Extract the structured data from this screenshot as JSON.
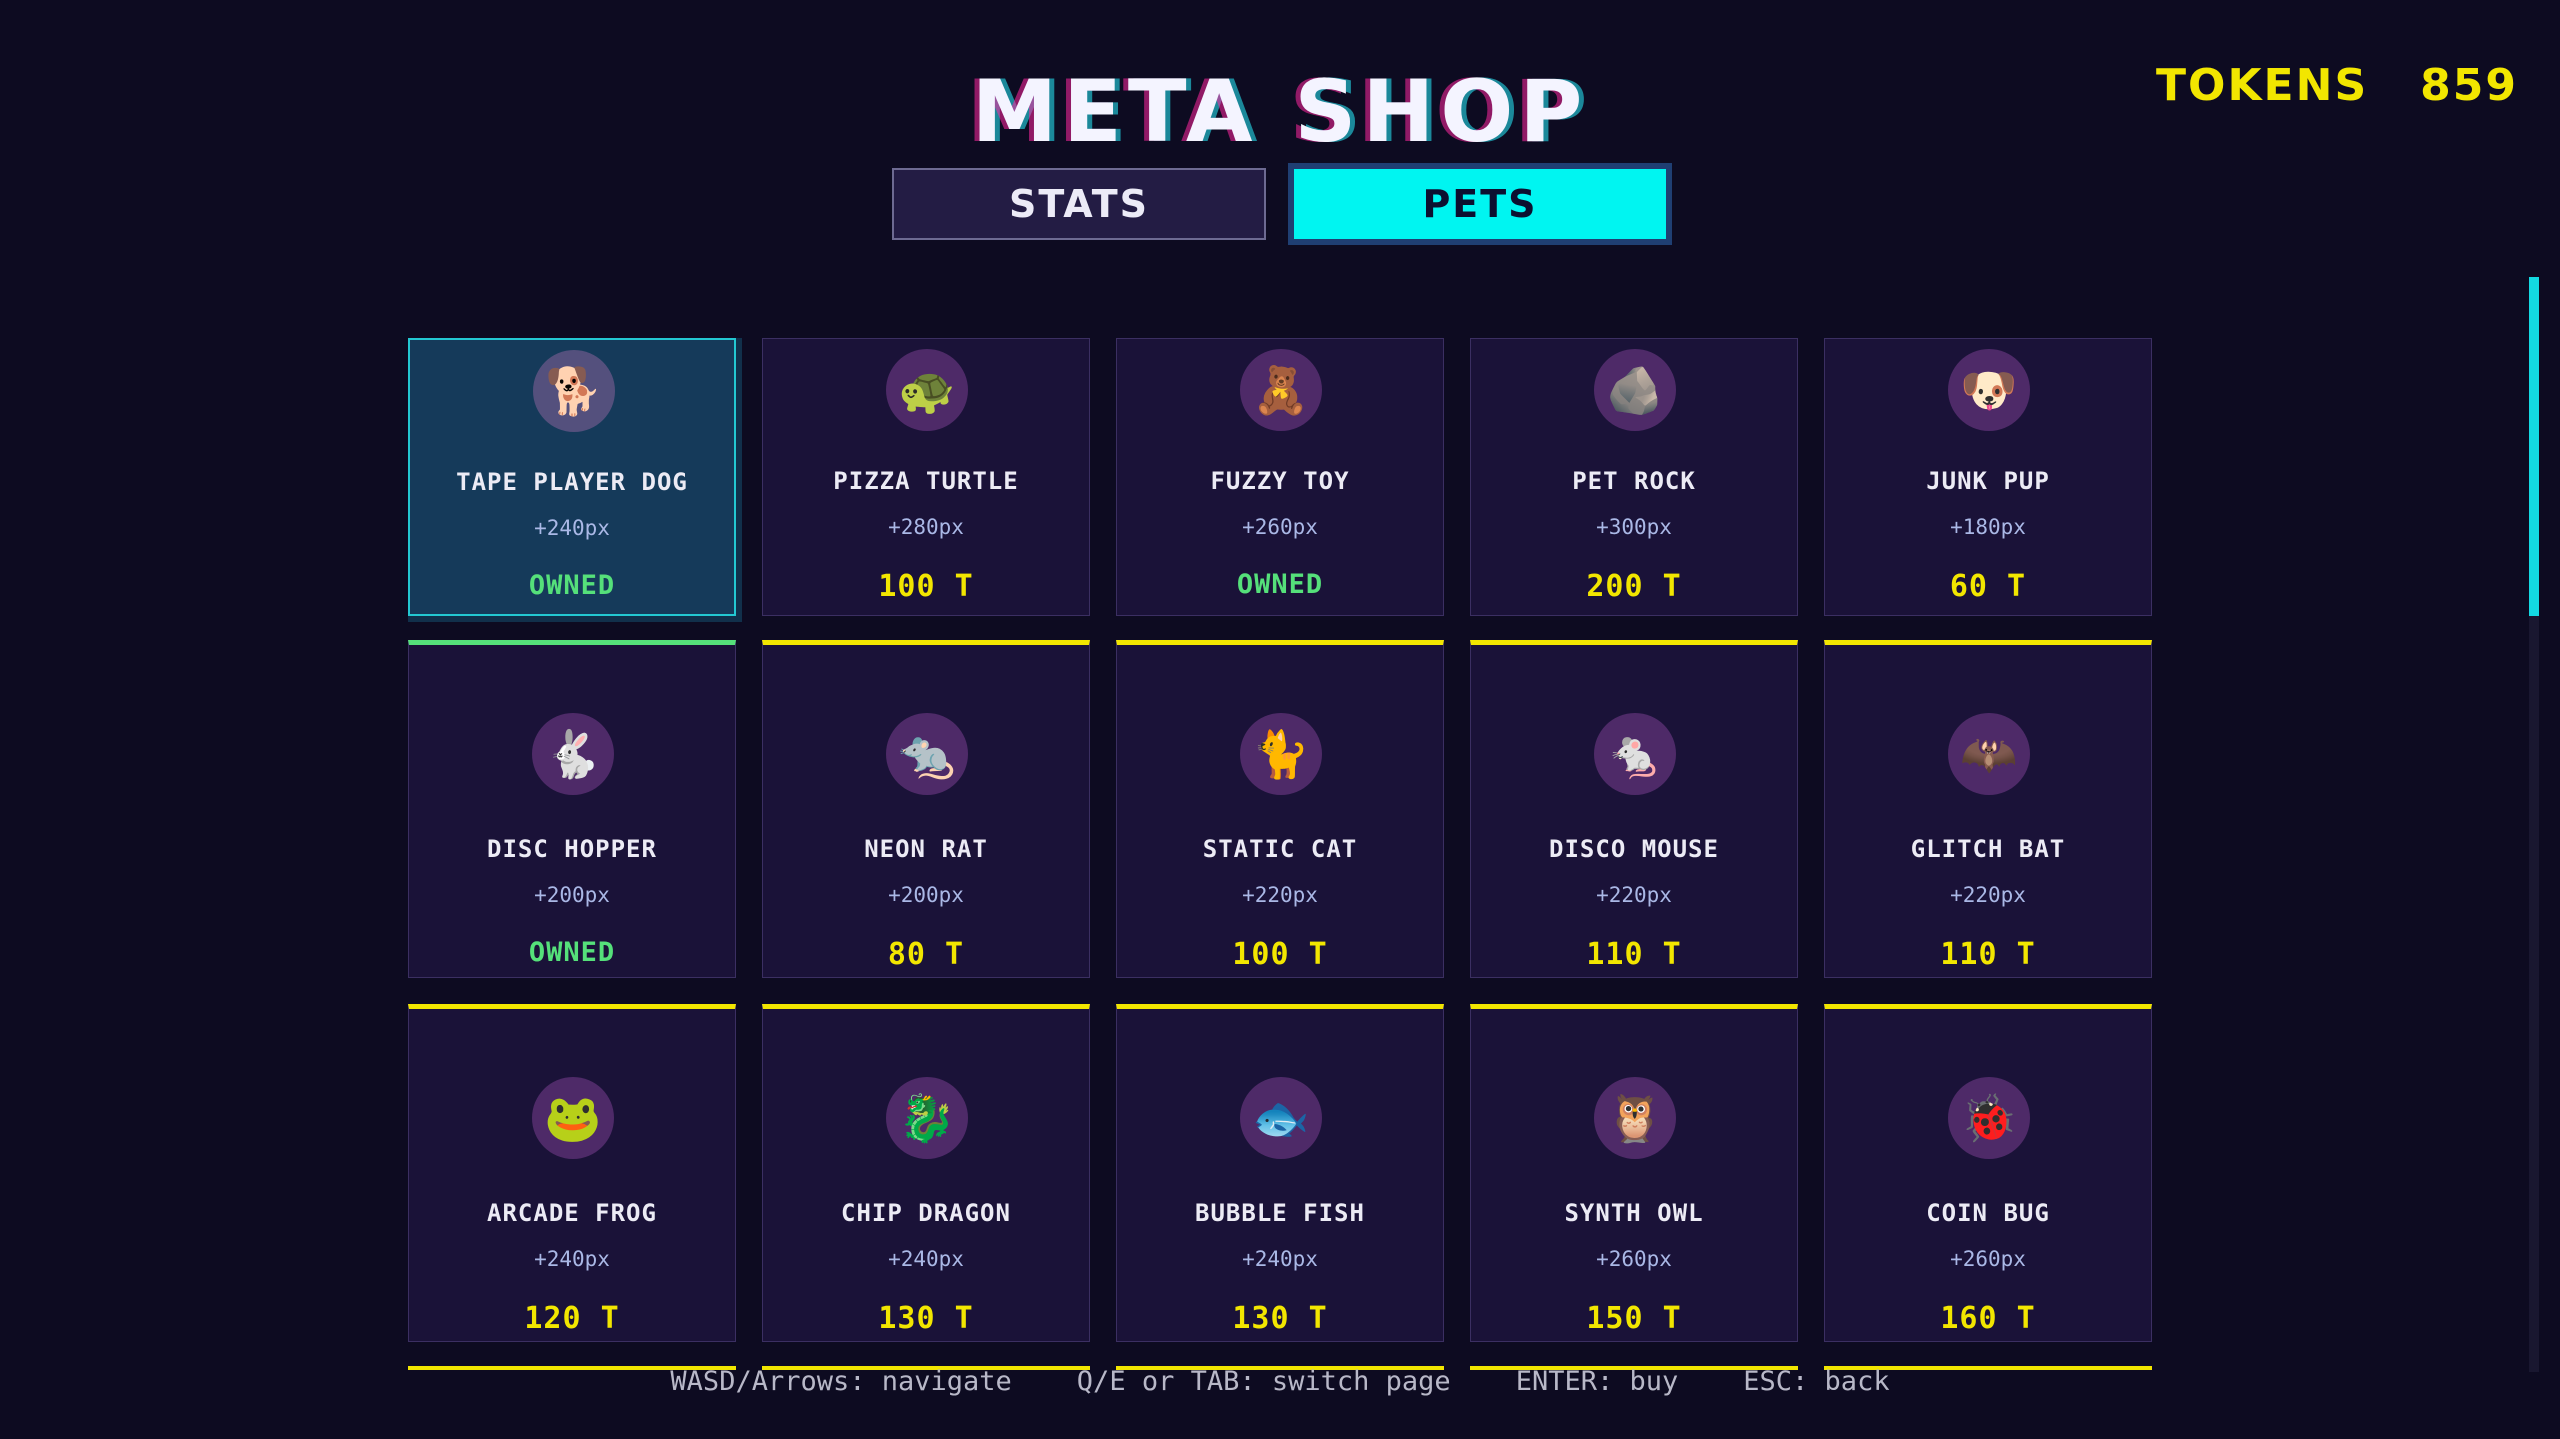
{
  "header": {
    "title": "META SHOP",
    "tokens_label": "TOKENS",
    "tokens_value": "859"
  },
  "tabs": [
    {
      "label": "STATS",
      "active": false
    },
    {
      "label": "PETS",
      "active": true
    }
  ],
  "pets": [
    {
      "name": "TAPE PLAYER DOG",
      "px": "+240px",
      "price": "OWNED",
      "owned": true,
      "selected": true,
      "icon": "dog-icon"
    },
    {
      "name": "PIZZA TURTLE",
      "px": "+280px",
      "price": "100 T",
      "owned": false,
      "icon": "turtle-icon"
    },
    {
      "name": "FUZZY TOY",
      "px": "+260px",
      "price": "OWNED",
      "owned": true,
      "icon": "fuzzy-toy-icon"
    },
    {
      "name": "PET ROCK",
      "px": "+300px",
      "price": "200 T",
      "owned": false,
      "icon": "rock-icon"
    },
    {
      "name": "JUNK PUP",
      "px": "+180px",
      "price": "60 T",
      "owned": false,
      "icon": "pup-icon"
    },
    {
      "name": "DISC HOPPER",
      "px": "+200px",
      "price": "OWNED",
      "owned": true,
      "icon": "rabbit-icon"
    },
    {
      "name": "NEON RAT",
      "px": "+200px",
      "price": "80 T",
      "owned": false,
      "icon": "rat-icon"
    },
    {
      "name": "STATIC CAT",
      "px": "+220px",
      "price": "100 T",
      "owned": false,
      "icon": "cat-icon"
    },
    {
      "name": "DISCO MOUSE",
      "px": "+220px",
      "price": "110 T",
      "owned": false,
      "icon": "mouse-icon"
    },
    {
      "name": "GLITCH BAT",
      "px": "+220px",
      "price": "110 T",
      "owned": false,
      "icon": "bat-icon"
    },
    {
      "name": "ARCADE FROG",
      "px": "+240px",
      "price": "120 T",
      "owned": false,
      "icon": "frog-icon"
    },
    {
      "name": "CHIP DRAGON",
      "px": "+240px",
      "price": "130 T",
      "owned": false,
      "icon": "dragon-icon"
    },
    {
      "name": "BUBBLE FISH",
      "px": "+240px",
      "price": "130 T",
      "owned": false,
      "icon": "fish-icon"
    },
    {
      "name": "SYNTH OWL",
      "px": "+260px",
      "price": "150 T",
      "owned": false,
      "icon": "owl-icon"
    },
    {
      "name": "COIN BUG",
      "px": "+260px",
      "price": "160 T",
      "owned": false,
      "icon": "bug-icon"
    }
  ],
  "controls": "WASD/Arrows: navigate    Q/E or TAB: switch page    ENTER: buy    ESC: back",
  "colors": {
    "background": "#0d0b21",
    "accent_cyan": "#00f5f1",
    "price_yellow": "#f2e600",
    "owned_green": "#55e07a",
    "card_bg": "#1a1238"
  },
  "scroll_fraction_visible": 0.31
}
